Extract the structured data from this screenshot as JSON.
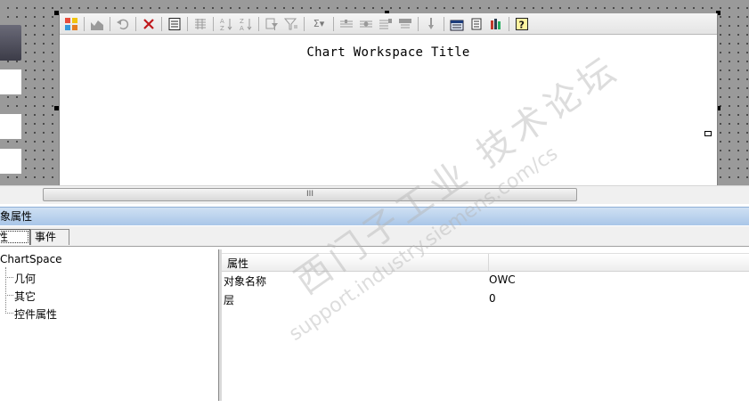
{
  "chart": {
    "title": "Chart Workspace Title"
  },
  "toolbar": {
    "buttons": [
      {
        "icon": "chart-wizard-icon"
      },
      {
        "icon": "chart-type-icon"
      },
      {
        "icon": "undo-icon"
      },
      {
        "icon": "delete-icon"
      },
      {
        "icon": "property-toolbox-icon"
      },
      {
        "icon": "show-field-list-icon"
      },
      {
        "icon": "sort-ascending-icon"
      },
      {
        "icon": "sort-descending-icon"
      },
      {
        "icon": "filter-by-selection-icon"
      },
      {
        "icon": "autofilter-icon"
      },
      {
        "icon": "autocalc-icon"
      },
      {
        "icon": "collapse-icon"
      },
      {
        "icon": "expand-icon"
      },
      {
        "icon": "show-top-bottom-icon"
      },
      {
        "icon": "hide-details-icon"
      },
      {
        "icon": "drill-icon"
      },
      {
        "icon": "export-icon"
      },
      {
        "icon": "commands-options-icon"
      },
      {
        "icon": "chart-data-icon"
      },
      {
        "icon": "help-icon"
      }
    ],
    "labels": {
      "sigma": "Σ▾"
    }
  },
  "scrollbar": {
    "grip": "III"
  },
  "panel": {
    "title": "象属性",
    "tabs": {
      "properties": "性",
      "events": "事件"
    },
    "tree": {
      "root": "ChartSpace",
      "children": [
        "几何",
        "其它",
        "控件属性"
      ]
    },
    "grid": {
      "header": "属性",
      "rows": [
        {
          "name": "对象名称",
          "value": "OWC"
        },
        {
          "name": "层",
          "value": "0"
        }
      ]
    }
  },
  "watermark": {
    "text_cn": "西门子工业 技术论坛",
    "text_url": "support.industry.siemens.com/cs"
  }
}
